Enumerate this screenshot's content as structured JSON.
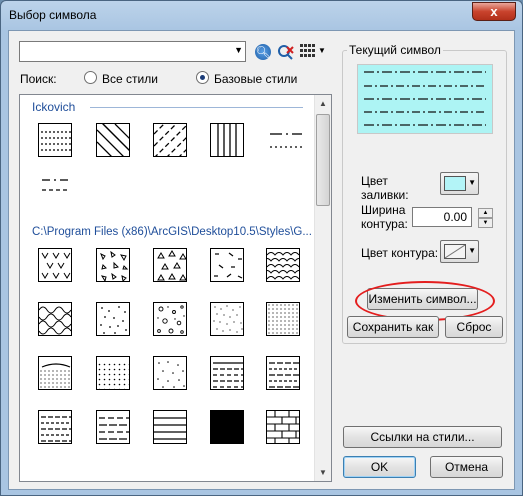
{
  "window": {
    "title": "Выбор символа",
    "close_glyph": "x"
  },
  "search": {
    "value": "",
    "placeholder": "",
    "search_icon": "magnifier-icon",
    "clear_icon": "clear-search-icon",
    "view_icon": "grid-view-icon"
  },
  "scope": {
    "label": "Поиск:",
    "options": [
      {
        "label": "Все стили",
        "checked": false
      },
      {
        "label": "Базовые стили",
        "checked": true
      }
    ]
  },
  "gallery": {
    "groups": [
      {
        "title": "Ickovich"
      },
      {
        "title": "C:\\Program Files (x86)\\ArcGIS\\Desktop10.5\\Styles\\G..."
      }
    ]
  },
  "current_symbol": {
    "group_title": "Текущий символ",
    "preview_fill": "#adf4f4",
    "fill_color_label": "Цвет заливки:",
    "fill_color": "#b3f4f7",
    "width_label": "Ширина контура:",
    "width_value": "0.00",
    "outline_color_label": "Цвет контура:",
    "outline_color": "none",
    "edit_button": "Изменить символ...",
    "save_as_button": "Сохранить как",
    "reset_button": "Сброс"
  },
  "footer": {
    "style_refs_button": "Ссылки на стили...",
    "ok_button": "OK",
    "cancel_button": "Отмена"
  },
  "colors": {
    "annotation": "#e41e1e",
    "link_text": "#1f4e9a"
  }
}
